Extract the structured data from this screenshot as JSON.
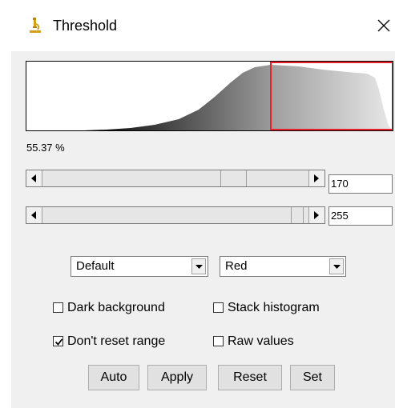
{
  "window": {
    "title": "Threshold",
    "icon": "microscope-icon",
    "close_icon": "close-icon"
  },
  "histogram": {
    "selection_color": "#e8202a",
    "threshold_min": 170,
    "threshold_max": 255
  },
  "percent_label": "55.37 %",
  "sliders": [
    {
      "name": "min",
      "value": "170"
    },
    {
      "name": "max",
      "value": "255"
    }
  ],
  "dropdowns": {
    "method": "Default",
    "display": "Red"
  },
  "checkboxes": [
    {
      "label": "Dark background",
      "checked": false
    },
    {
      "label": "Stack histogram",
      "checked": false
    },
    {
      "label": "Don't reset range",
      "checked": true
    },
    {
      "label": "Raw values",
      "checked": false
    }
  ],
  "buttons": {
    "auto": "Auto",
    "apply": "Apply",
    "reset": "Reset",
    "set": "Set"
  }
}
